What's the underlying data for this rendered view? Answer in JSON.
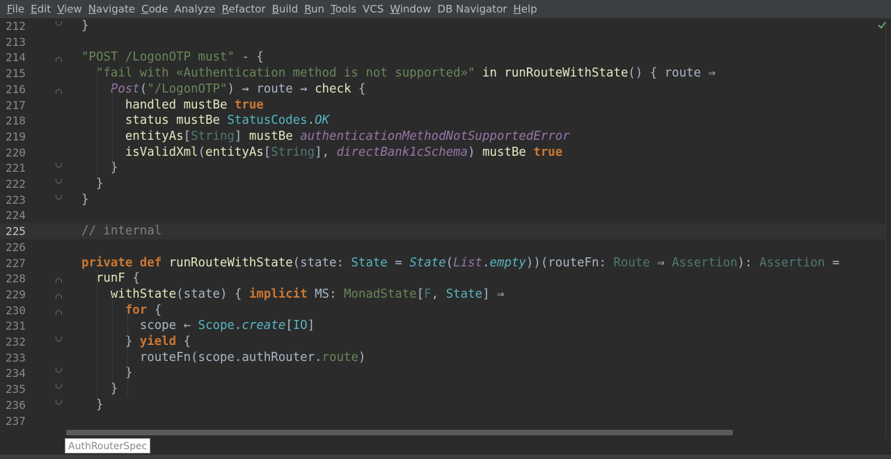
{
  "menu": [
    {
      "m": "F",
      "rest": "ile"
    },
    {
      "m": "E",
      "rest": "dit"
    },
    {
      "m": "V",
      "rest": "iew"
    },
    {
      "m": "N",
      "rest": "avigate"
    },
    {
      "m": "C",
      "rest": "ode"
    },
    {
      "m": "",
      "rest": "Analyze"
    },
    {
      "m": "R",
      "rest": "efactor"
    },
    {
      "m": "B",
      "rest": "uild"
    },
    {
      "m": "R",
      "rest": "un"
    },
    {
      "m": "T",
      "rest": "ools"
    },
    {
      "m": "",
      "rest": "VCS"
    },
    {
      "m": "W",
      "rest": "indow"
    },
    {
      "m": "",
      "rest": "DB Navigator"
    },
    {
      "m": "H",
      "rest": "elp"
    }
  ],
  "editor": {
    "current_line": "225",
    "lines": [
      {
        "n": "212",
        "fold": "end",
        "code": [
          [
            "",
            "}"
          ]
        ]
      },
      {
        "n": "213",
        "fold": "",
        "code": []
      },
      {
        "n": "214",
        "fold": "start",
        "code": [
          [
            "str",
            "\"POST /LogonOTP must\""
          ],
          [
            "",
            " - {"
          ]
        ]
      },
      {
        "n": "215",
        "fold": "",
        "code": [
          [
            "",
            "  "
          ],
          [
            "str",
            "\"fail with «Authentication method is not supported»\""
          ],
          [
            "",
            " "
          ],
          [
            "fn",
            "in runRouteWithState"
          ],
          [
            "",
            "() { route ⇒"
          ]
        ]
      },
      {
        "n": "216",
        "fold": "start",
        "code": [
          [
            "",
            "    "
          ],
          [
            "purp",
            "Post"
          ],
          [
            "",
            "("
          ],
          [
            "str",
            "\"/LogonOTP\""
          ],
          [
            "",
            ") ⇝ route ⇝ "
          ],
          [
            "fn",
            "check"
          ],
          [
            "",
            " {"
          ]
        ]
      },
      {
        "n": "217",
        "fold": "",
        "code": [
          [
            "",
            "      "
          ],
          [
            "fn",
            "handled mustBe "
          ],
          [
            "tru",
            "true"
          ]
        ]
      },
      {
        "n": "218",
        "fold": "",
        "code": [
          [
            "",
            "      "
          ],
          [
            "fn",
            "status mustBe "
          ],
          [
            "type",
            "StatusCodes"
          ],
          [
            "",
            "."
          ],
          [
            "typei",
            "OK"
          ]
        ]
      },
      {
        "n": "219",
        "fold": "",
        "code": [
          [
            "",
            "      "
          ],
          [
            "fn",
            "entityAs"
          ],
          [
            "",
            "["
          ],
          [
            "gen",
            "String"
          ],
          [
            "",
            "] "
          ],
          [
            "fn",
            "mustBe "
          ],
          [
            "purp",
            "authenticationMethodNotSupportedError"
          ]
        ]
      },
      {
        "n": "220",
        "fold": "",
        "code": [
          [
            "",
            "      "
          ],
          [
            "fn",
            "isValidXml"
          ],
          [
            "",
            "("
          ],
          [
            "fn",
            "entityAs"
          ],
          [
            "",
            "["
          ],
          [
            "gen",
            "String"
          ],
          [
            "",
            "], "
          ],
          [
            "purp",
            "directBank1cSchema"
          ],
          [
            "",
            ") "
          ],
          [
            "fn",
            "mustBe "
          ],
          [
            "tru",
            "true"
          ]
        ]
      },
      {
        "n": "221",
        "fold": "end",
        "code": [
          [
            "",
            "    }"
          ]
        ]
      },
      {
        "n": "222",
        "fold": "end",
        "code": [
          [
            "",
            "  }"
          ]
        ]
      },
      {
        "n": "223",
        "fold": "end",
        "code": [
          [
            "",
            "}"
          ]
        ]
      },
      {
        "n": "224",
        "fold": "",
        "code": []
      },
      {
        "n": "225",
        "fold": "",
        "code": [
          [
            "cm",
            "// internal"
          ]
        ]
      },
      {
        "n": "226",
        "fold": "",
        "code": []
      },
      {
        "n": "227",
        "fold": "",
        "code": [
          [
            "kw",
            "private def "
          ],
          [
            "fn",
            "runRouteWithState"
          ],
          [
            "",
            "(state: "
          ],
          [
            "type",
            "State"
          ],
          [
            "",
            " = "
          ],
          [
            "typei",
            "State"
          ],
          [
            "",
            "("
          ],
          [
            "purp",
            "List"
          ],
          [
            "",
            "."
          ],
          [
            "typei",
            "empty"
          ],
          [
            "",
            "))(routeFn: "
          ],
          [
            "gen",
            "Route"
          ],
          [
            "",
            " ⇒ "
          ],
          [
            "gen",
            "Assertion"
          ],
          [
            "",
            "): "
          ],
          [
            "gen",
            "Assertion"
          ],
          [
            "",
            " ="
          ]
        ]
      },
      {
        "n": "228",
        "fold": "start",
        "code": [
          [
            "",
            "  "
          ],
          [
            "fn",
            "runF"
          ],
          [
            "",
            " {"
          ]
        ]
      },
      {
        "n": "229",
        "fold": "start",
        "code": [
          [
            "",
            "    "
          ],
          [
            "fn",
            "withState"
          ],
          [
            "",
            "(state) { "
          ],
          [
            "kw",
            "implicit "
          ],
          [
            "",
            "MS: "
          ],
          [
            "str",
            "MonadState"
          ],
          [
            "",
            "["
          ],
          [
            "gen",
            "F"
          ],
          [
            "",
            ", "
          ],
          [
            "type",
            "State"
          ],
          [
            "",
            "] ⇒"
          ]
        ]
      },
      {
        "n": "230",
        "fold": "start",
        "code": [
          [
            "",
            "      "
          ],
          [
            "kw",
            "for"
          ],
          [
            "",
            " {"
          ]
        ]
      },
      {
        "n": "231",
        "fold": "",
        "code": [
          [
            "",
            "        scope ← "
          ],
          [
            "type",
            "Scope"
          ],
          [
            "",
            "."
          ],
          [
            "typei",
            "create"
          ],
          [
            "",
            "["
          ],
          [
            "type",
            "IO"
          ],
          [
            "",
            "]"
          ]
        ]
      },
      {
        "n": "232",
        "fold": "end",
        "code": [
          [
            "",
            "      } "
          ],
          [
            "kw",
            "yield"
          ],
          [
            "",
            " {"
          ]
        ]
      },
      {
        "n": "233",
        "fold": "",
        "code": [
          [
            "",
            "        routeFn(scope.authRouter."
          ],
          [
            "str",
            "route"
          ],
          [
            "",
            ")"
          ]
        ]
      },
      {
        "n": "234",
        "fold": "end",
        "code": [
          [
            "",
            "      }"
          ]
        ]
      },
      {
        "n": "235",
        "fold": "end",
        "code": [
          [
            "",
            "    }"
          ]
        ]
      },
      {
        "n": "236",
        "fold": "end",
        "code": [
          [
            "",
            "  }"
          ]
        ]
      },
      {
        "n": "237",
        "fold": "",
        "code": []
      }
    ]
  },
  "breadcrumb": {
    "label": "AuthRouterSpec"
  },
  "colors": {
    "background": "#2b2b2b",
    "menubar": "#3c3f41",
    "keyword": "#cc7832",
    "string": "#6a8759",
    "type": "#56b6c2",
    "italic_member": "#9876aa"
  },
  "icons": {
    "inspection": "check-icon"
  }
}
